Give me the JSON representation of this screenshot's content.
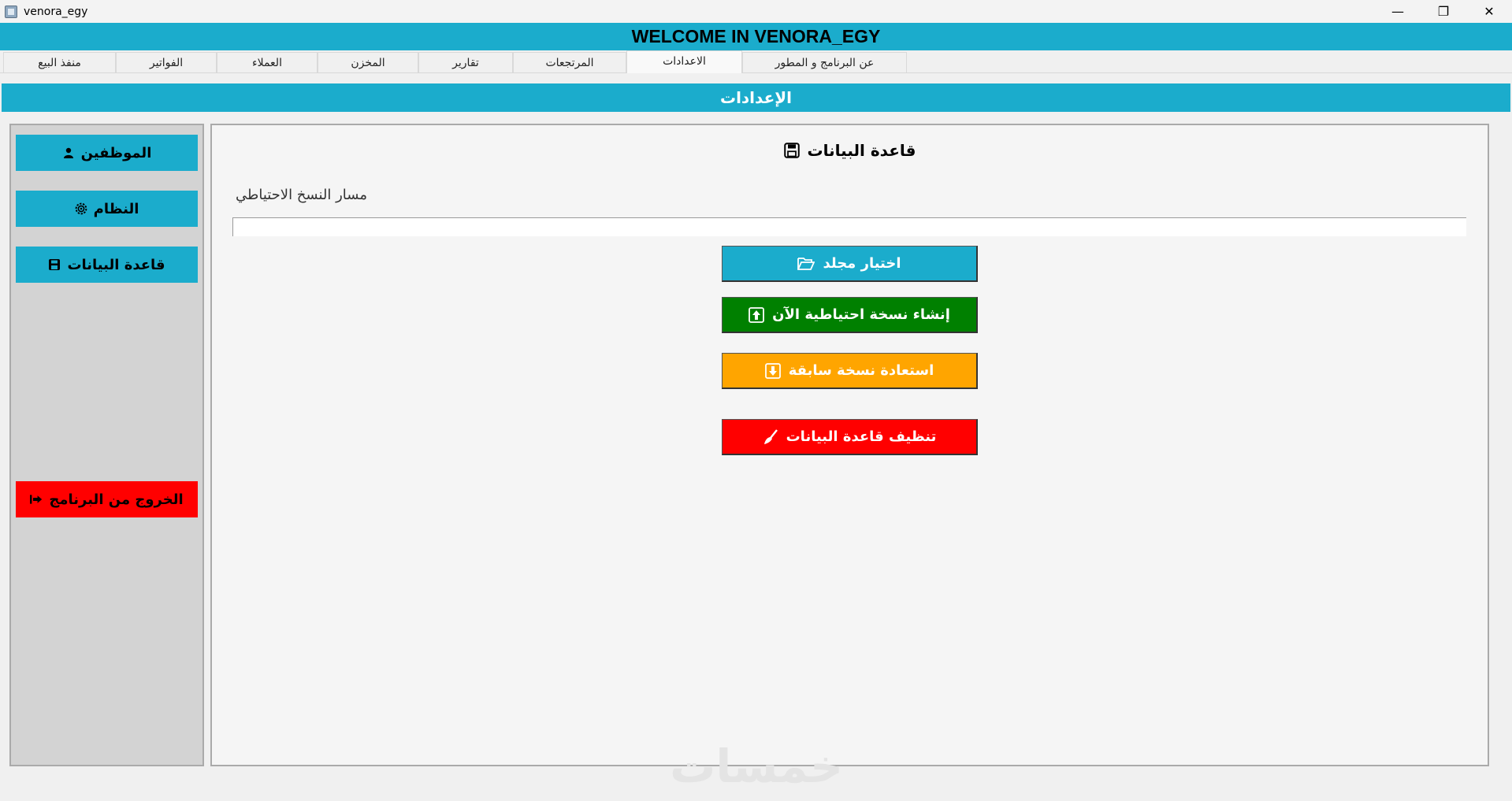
{
  "window": {
    "title": "venora_egy",
    "controls": {
      "minimize": "—",
      "restore": "❐",
      "close": "✕"
    }
  },
  "banner": {
    "text": "WELCOME IN VENORA_EGY"
  },
  "tabs": [
    {
      "label": "منفذ البيع"
    },
    {
      "label": "الفواتير"
    },
    {
      "label": "العملاء"
    },
    {
      "label": "المخزن"
    },
    {
      "label": "تقارير"
    },
    {
      "label": "المرتجعات"
    },
    {
      "label": "الاعدادات"
    },
    {
      "label": "عن البرنامج و المطور"
    }
  ],
  "section": {
    "title": "الإعدادات"
  },
  "sidebar": {
    "employees": "الموظفين",
    "system": "النظام",
    "database": "قاعدة البيانات",
    "exit": "الخروج من البرنامج"
  },
  "main": {
    "title": "قاعدة البيانات",
    "path_label": "مسار النسخ الاحتياطي",
    "path_value": "",
    "buttons": {
      "choose_folder": "اختيار مجلد",
      "backup_now": "إنشاء نسخة احتياطية الآن",
      "restore": "استعادة نسخة سابقة",
      "clean_db": "تنظيف قاعدة البيانات"
    }
  },
  "watermark": "خمسات",
  "colors": {
    "accent": "#1baccc",
    "success": "#008000",
    "warning": "#ffa500",
    "danger": "#ff0000"
  }
}
